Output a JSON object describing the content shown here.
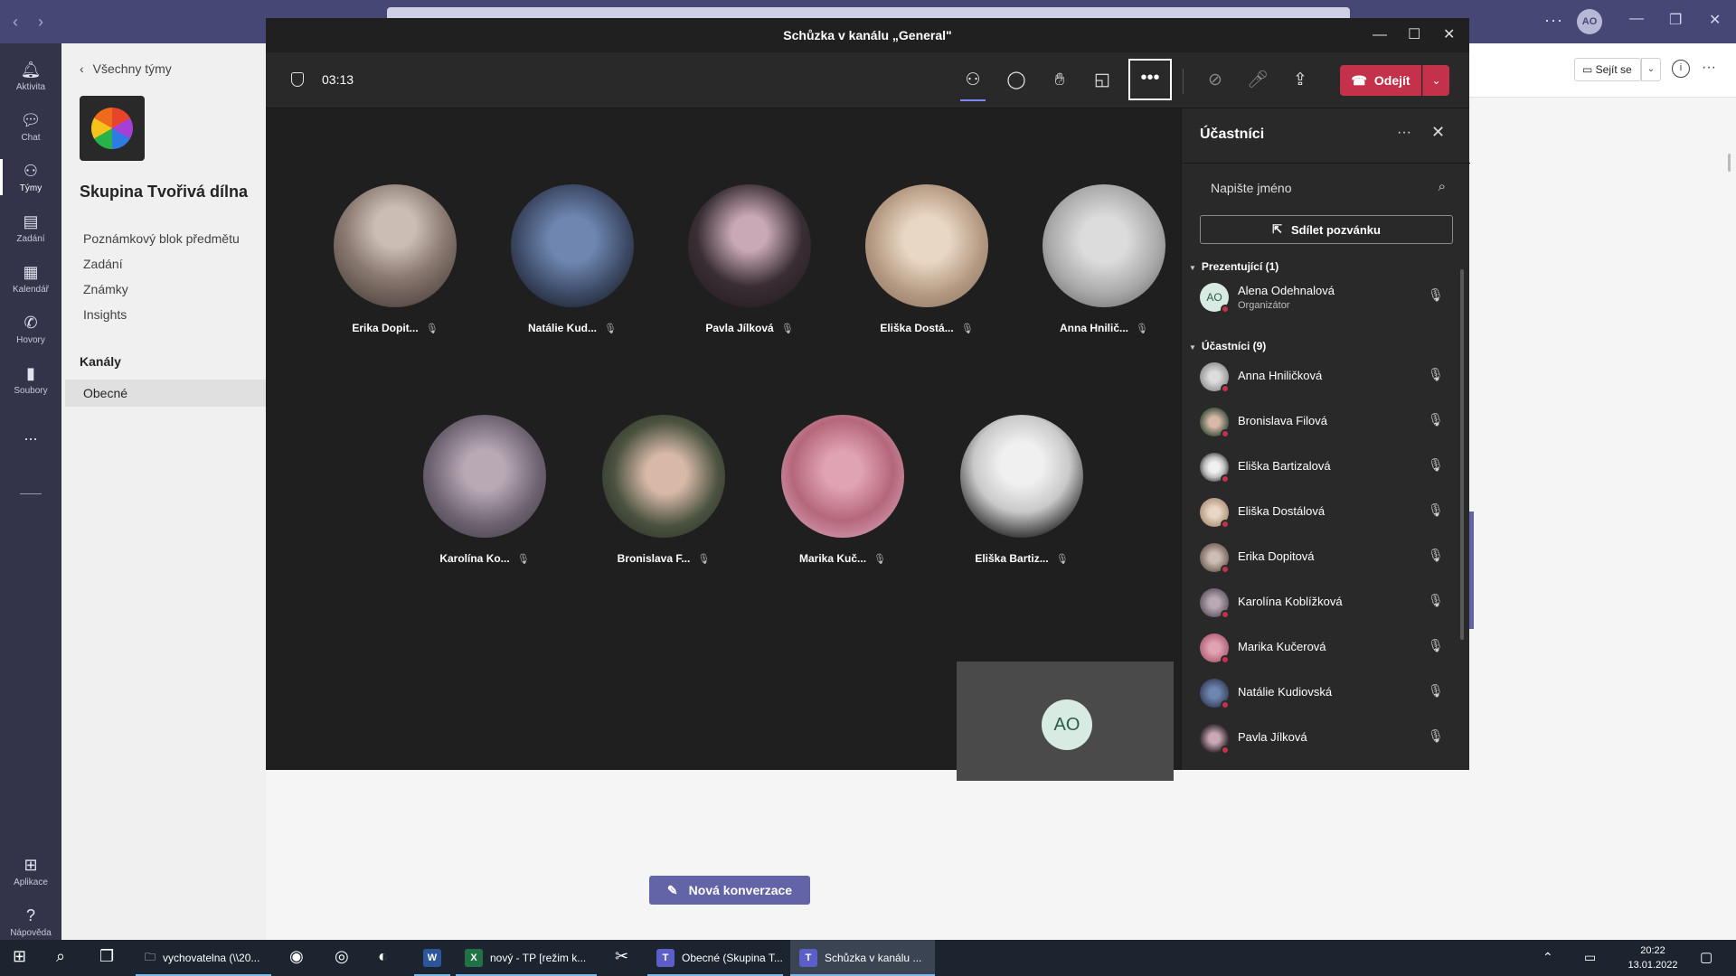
{
  "teams_titlebar": {
    "user_initials": "AO"
  },
  "rail": {
    "items": [
      {
        "label": "Aktivita",
        "icon": "bell-icon"
      },
      {
        "label": "Chat",
        "icon": "chat-icon"
      },
      {
        "label": "Týmy",
        "icon": "teams-icon"
      },
      {
        "label": "Zadání",
        "icon": "assignments-icon"
      },
      {
        "label": "Kalendář",
        "icon": "calendar-icon"
      },
      {
        "label": "Hovory",
        "icon": "phone-icon"
      },
      {
        "label": "Soubory",
        "icon": "file-icon"
      }
    ],
    "more": "...",
    "apps": "Aplikace",
    "help": "Nápověda"
  },
  "left_panel": {
    "back_label": "Všechny týmy",
    "team_name": "Skupina Tvořivá dílna",
    "links": [
      "Poznámkový blok předmětu",
      "Zadání",
      "Známky",
      "Insights"
    ],
    "channels_heading": "Kanály",
    "channel": "Obecné"
  },
  "background": {
    "meet_button": "Sejít se",
    "new_conversation": "Nová konverzace"
  },
  "meeting": {
    "window_title": "Schůzka v kanálu „General\"",
    "timer": "03:13",
    "leave_label": "Odejít",
    "more_label": "•••",
    "self_initials": "AO",
    "accent": "#c4314b",
    "tiles_row1": [
      {
        "name": "Erika Dopit...",
        "photo": "#8a7a72"
      },
      {
        "name": "Natálie Kud...",
        "photo": "#3d4a66"
      },
      {
        "name": "Pavla Jílková",
        "photo": "#3a2e35"
      },
      {
        "name": "Eliška Dostá...",
        "photo": "#b59a82"
      },
      {
        "name": "Anna Hnilič...",
        "photo": "#a9a9a9"
      }
    ],
    "tiles_row2": [
      {
        "name": "Karolína Ko...",
        "photo": "#6d6270"
      },
      {
        "name": "Bronislava F...",
        "photo": "#4b5240"
      },
      {
        "name": "Marika Kuč...",
        "photo": "#b5677a"
      },
      {
        "name": "Eliška Bartiz...",
        "photo": "#c9c9c9"
      }
    ]
  },
  "participants": {
    "title": "Účastníci",
    "search_placeholder": "Napište jméno",
    "share_invite": "Sdílet pozvánku",
    "presenters_heading": "Prezentující (1)",
    "attendees_heading": "Účastníci (9)",
    "presenter": {
      "name": "Alena Odehnalová",
      "role": "Organizátor",
      "initials": "AO"
    },
    "attendees": [
      {
        "name": "Anna Hniličková",
        "photo": "#9a9a9a"
      },
      {
        "name": "Bronislava Filová",
        "photo": "#4b5a48"
      },
      {
        "name": "Eliška Bartizalová",
        "photo": "#bdbdbd"
      },
      {
        "name": "Eliška Dostálová",
        "photo": "#b59a82"
      },
      {
        "name": "Erika Dopitová",
        "photo": "#7d6a63"
      },
      {
        "name": "Karolína Koblížková",
        "photo": "#6d6270"
      },
      {
        "name": "Marika Kučerová",
        "photo": "#b5677a"
      },
      {
        "name": "Natálie Kudiovská",
        "photo": "#3d4a66"
      },
      {
        "name": "Pavla Jílková",
        "photo": "#3a2e35"
      }
    ]
  },
  "taskbar": {
    "apps": [
      {
        "label": "vychovatelna (\\\\20...",
        "icon": "folder-icon"
      },
      {
        "label": "nový - TP [režim k...",
        "icon": "excel-icon"
      },
      {
        "label": "Obecné (Skupina T...",
        "icon": "teams-app-icon"
      },
      {
        "label": "Schůzka v kanálu ...",
        "icon": "teams-app-icon"
      }
    ],
    "time": "20:22",
    "date": "13.01.2022"
  }
}
